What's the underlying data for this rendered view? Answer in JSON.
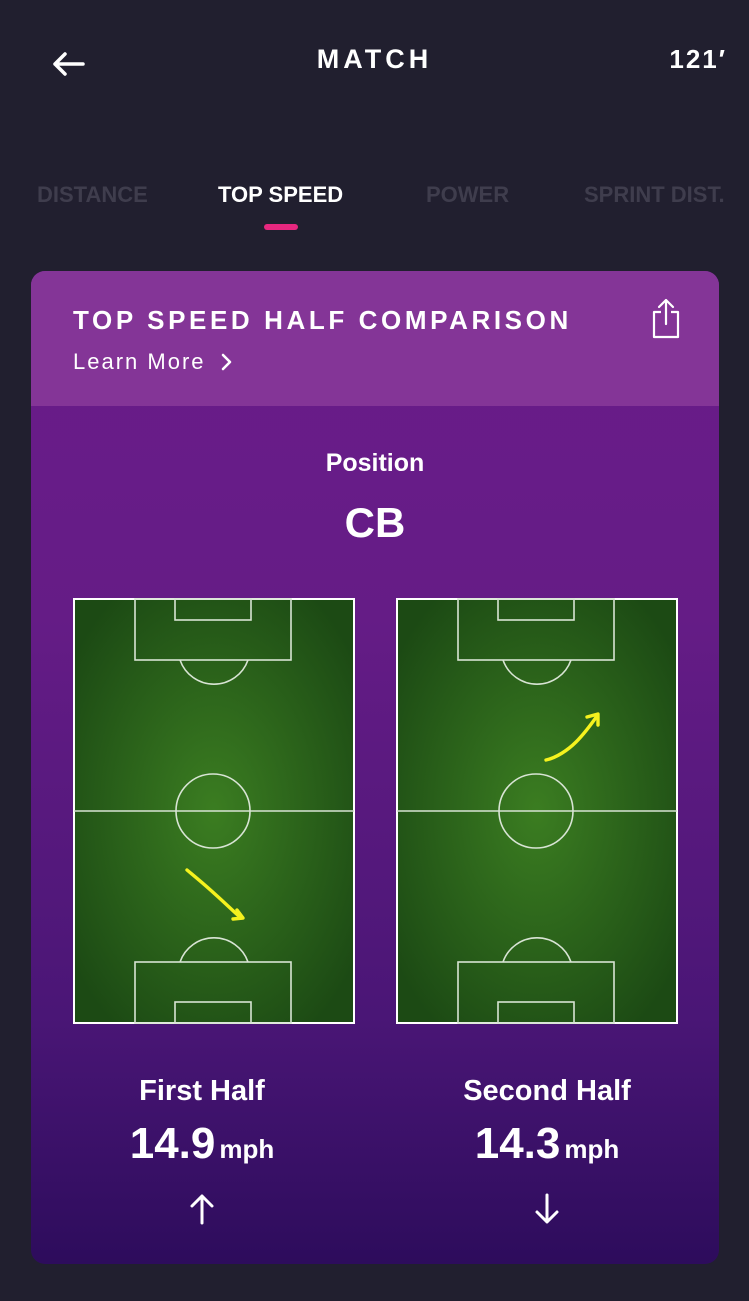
{
  "header": {
    "title": "MATCH",
    "time": "121′"
  },
  "tabs": [
    {
      "label": "DISTANCE",
      "active": false
    },
    {
      "label": "TOP SPEED",
      "active": true
    },
    {
      "label": "POWER",
      "active": false
    },
    {
      "label": "SPRINT DIST.",
      "active": false
    }
  ],
  "card": {
    "title": "TOP SPEED HALF COMPARISON",
    "learn_more": "Learn More",
    "position_label": "Position",
    "position_value": "CB",
    "halves": [
      {
        "label": "First Half",
        "value": "14.9",
        "unit": "mph",
        "trend": "up"
      },
      {
        "label": "Second Half",
        "value": "14.3",
        "unit": "mph",
        "trend": "down"
      }
    ]
  },
  "colors": {
    "background": "#211f2f",
    "accent": "#e6277f",
    "card_header": "#843597",
    "pitch_green": "#2f6a1c",
    "sprint_path": "#f5f21e"
  },
  "icons": [
    "back-arrow-icon",
    "share-icon",
    "chevron-right-icon",
    "trend-up-arrow-icon",
    "trend-down-arrow-icon"
  ]
}
